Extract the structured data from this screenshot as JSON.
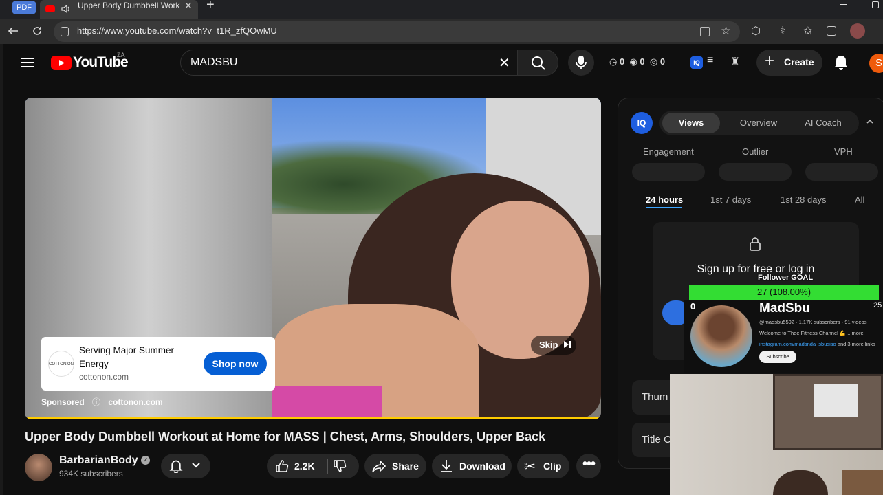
{
  "browser": {
    "pdf_badge": "PDF",
    "tab_title": "Upper Body Dumbbell Work",
    "url": "https://www.youtube.com/watch?v=t1R_zfQOwMU"
  },
  "header": {
    "logo_text": "YouTube",
    "region": "ZA",
    "search_value": "MADSBU",
    "stat_a": "0",
    "stat_b": "0",
    "stat_c": "0",
    "create_label": "Create",
    "avatar_letter": "S",
    "colors": {
      "accent": "#ff0000",
      "avatar": "#ef5b0c"
    }
  },
  "ad": {
    "brand_logo_text": "COTTON:ON",
    "headline": "Serving Major Summer Energy",
    "domain": "cottonon.com",
    "cta": "Shop now",
    "sponsored": "Sponsored",
    "sponsor_domain": "cottonon.com",
    "skip": "Skip",
    "colors": {
      "cta": "#065fd4",
      "progress": "#ffcc00"
    }
  },
  "video": {
    "title": "Upper Body Dumbbell Workout at Home for MASS | Chest, Arms, Shoulders, Upper Back",
    "channel": "BarbarianBody",
    "subscribers": "934K subscribers",
    "likes": "2.2K",
    "share": "Share",
    "download": "Download",
    "clip": "Clip"
  },
  "panel": {
    "tabs": [
      "Views",
      "Overview",
      "AI Coach"
    ],
    "metrics": [
      "Engagement",
      "Outlier",
      "VPH"
    ],
    "ranges": [
      "24 hours",
      "1st 7 days",
      "1st 28 days",
      "All"
    ],
    "signup_text": "Sign up for free or log in",
    "side_items": [
      "Thum",
      "Title C"
    ]
  },
  "overlay": {
    "goal_label": "Follower GOAL",
    "goal_value": "27 (108.00%)",
    "goal_min": "0",
    "goal_max": "25",
    "goal_progress": 1.0,
    "channel_name": "MadSbu",
    "channel_meta": "@madsbu5592 · 1.17K subscribers · 91 videos",
    "channel_desc": "Welcome to Thee Fitness Channel 💪 ...more",
    "channel_links": "instagram.com/madsnda_sbusiso",
    "channel_links_more": "and 3 more links",
    "subscribe": "Subscribe",
    "colors": {
      "goal": "#33dd33"
    }
  }
}
